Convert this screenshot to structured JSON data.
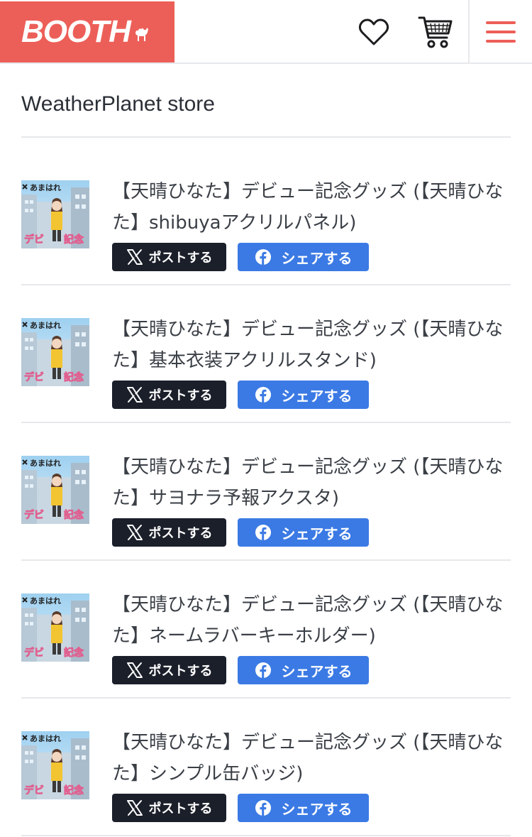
{
  "header": {
    "logo_text": "BOOTH",
    "brand_color": "#ec5f58",
    "icons": [
      "heart-icon",
      "cart-icon",
      "hamburger-menu-icon"
    ]
  },
  "store": {
    "title": "WeatherPlanet store"
  },
  "items": [
    {
      "title": "【天晴ひなた】デビュー記念グッズ (【天晴ひなた】shibuyaアクリルパネル)",
      "post_label": "ポストする",
      "share_label": "シェアする"
    },
    {
      "title": "【天晴ひなた】デビュー記念グッズ (【天晴ひなた】基本衣装アクリルスタンド)",
      "post_label": "ポストする",
      "share_label": "シェアする"
    },
    {
      "title": "【天晴ひなた】デビュー記念グッズ (【天晴ひなた】サヨナラ予報アクスタ)",
      "post_label": "ポストする",
      "share_label": "シェアする"
    },
    {
      "title": "【天晴ひなた】デビュー記念グッズ (【天晴ひなた】ネームラバーキーホルダー)",
      "post_label": "ポストする",
      "share_label": "シェアする"
    },
    {
      "title": "【天晴ひなた】デビュー記念グッズ (【天晴ひなた】シンプル缶バッジ)",
      "post_label": "ポストする",
      "share_label": "シェアする"
    }
  ],
  "colors": {
    "x_button": "#1b1f2a",
    "facebook_button": "#3b7ae4",
    "divider": "#e6e8eb"
  }
}
